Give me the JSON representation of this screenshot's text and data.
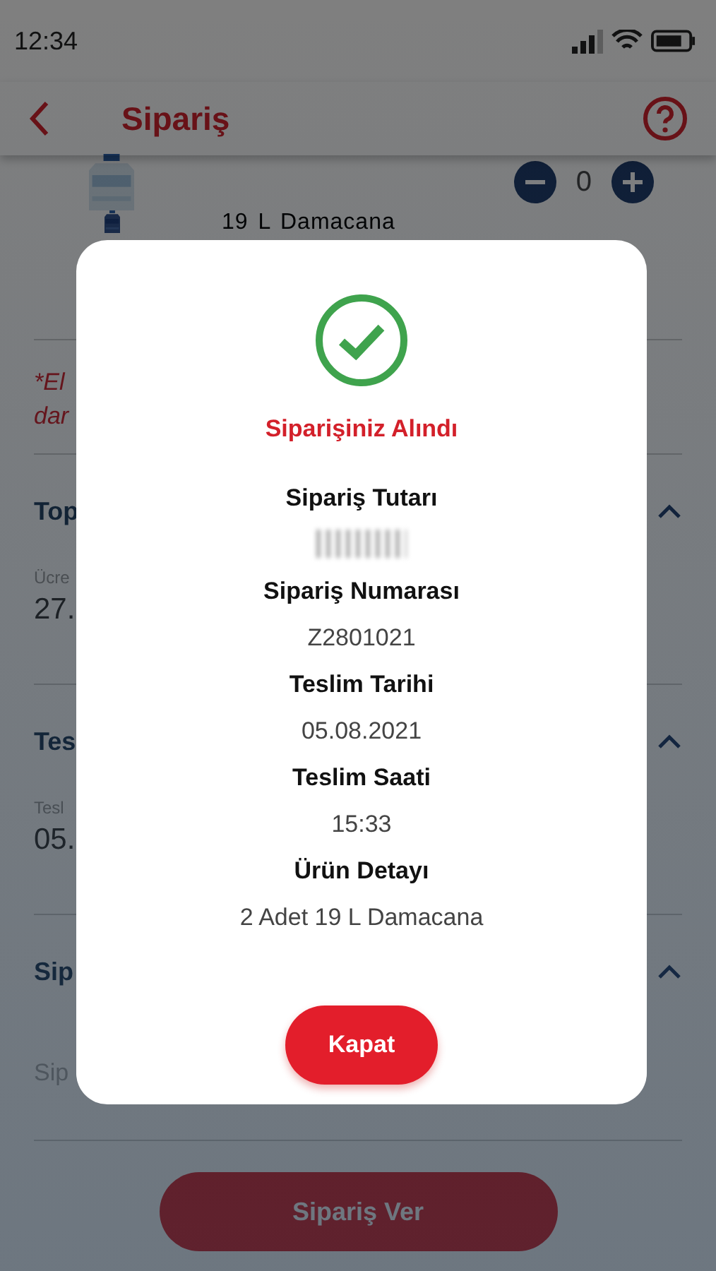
{
  "status_bar": {
    "time": "12:34"
  },
  "header": {
    "title": "Sipariş"
  },
  "products": [
    {
      "kind": "counter",
      "quantity": "0"
    },
    {
      "kind": "name",
      "name": "19 L Damacana"
    }
  ],
  "note": [
    "*El",
    "dar"
  ],
  "sections": [
    {
      "title": "Top",
      "expanded": true,
      "field_label": "Ücre",
      "field_value": "27."
    },
    {
      "title": "Tes",
      "expanded": true,
      "field_label": "Tesl",
      "field_value": "05."
    },
    {
      "title": "Sip",
      "expanded": true,
      "placeholder": "Sip"
    }
  ],
  "submit_button": "Sipariş Ver",
  "dialog": {
    "title": "Siparişiniz Alındı",
    "details": [
      {
        "label": "Sipariş Tutarı",
        "value_hidden": true
      },
      {
        "label": "Sipariş Numarası",
        "value": "Z2801021"
      },
      {
        "label": "Teslim Tarihi",
        "value": "05.08.2021"
      },
      {
        "label": "Teslim Saati",
        "value": "15:33"
      },
      {
        "label": "Ürün Detayı",
        "value": "2 Adet 19 L Damacana"
      }
    ],
    "close_button": "Kapat"
  }
}
